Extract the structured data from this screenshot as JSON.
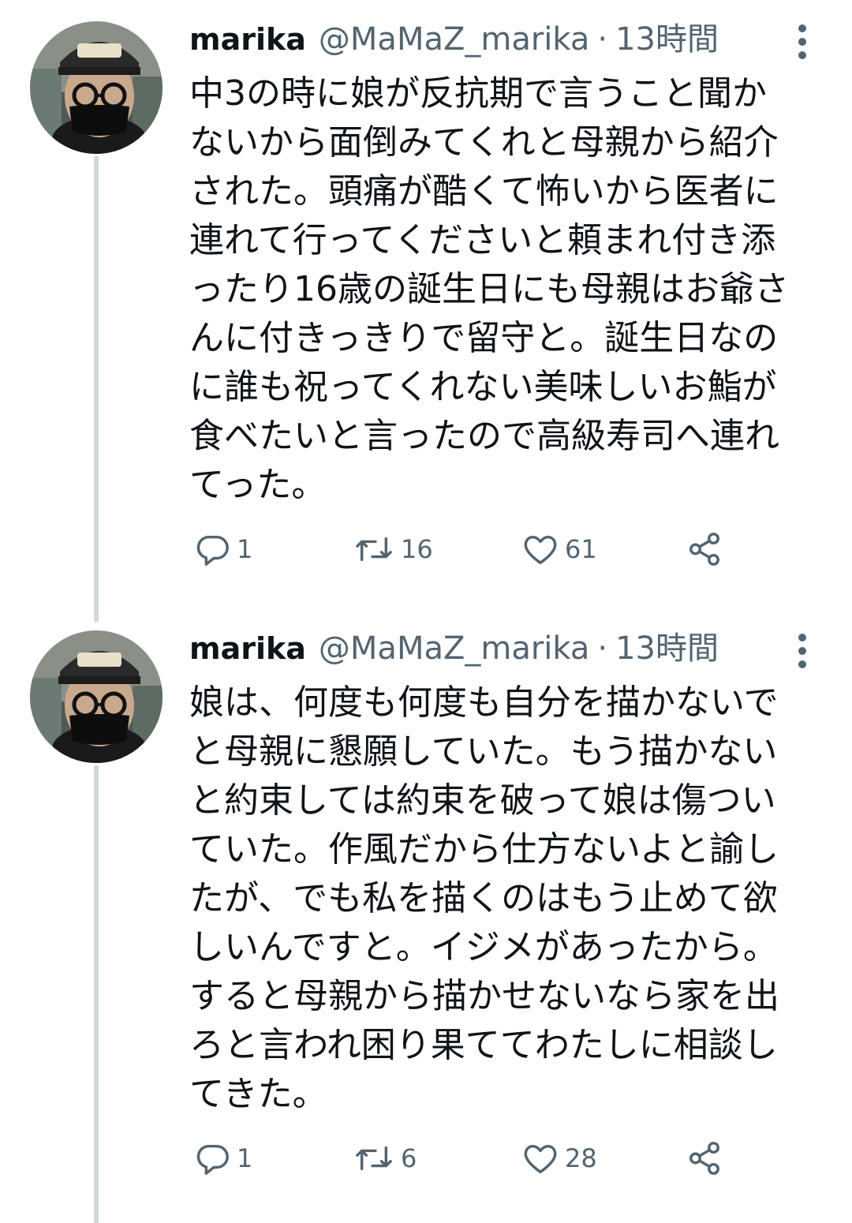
{
  "tweets": [
    {
      "author_name": "marika",
      "author_handle": "@MaMaZ_marika",
      "separator": "·",
      "time": "13時間",
      "lines": [
        "中3の時に娘が反抗期で言うこと聞か",
        "ないから面倒みてくれと母親から紹介",
        "された。頭痛が酷くて怖いから医者に",
        "連れて行ってくださいと頼まれ付き添",
        "ったり16歳の誕生日にも母親はお爺さ",
        "んに付きっきりで留守と。誕生日なの",
        "に誰も祝ってくれない美味しいお鮨が",
        "食べたいと言ったので高級寿司へ連れ",
        "てった。"
      ],
      "reply_count": "1",
      "retweet_count": "16",
      "like_count": "61"
    },
    {
      "author_name": "marika",
      "author_handle": "@MaMaZ_marika",
      "separator": "·",
      "time": "13時間",
      "lines": [
        "娘は、何度も何度も自分を描かないで",
        "と母親に懇願していた。もう描かない",
        "と約束しては約束を破って娘は傷つい",
        "ていた。作風だから仕方ないよと諭し",
        "たが、でも私を描くのはもう止めて欲",
        "しいんですと。イジメがあったから。",
        "すると母親から描かせないなら家を出",
        "ろと言われ困り果ててわたしに相談し",
        "てきた。"
      ],
      "reply_count": "1",
      "retweet_count": "6",
      "like_count": "28"
    }
  ],
  "icons": {
    "avatar": "user-avatar",
    "more": "more-vertical-icon",
    "reply": "reply-icon",
    "retweet": "retweet-icon",
    "like": "heart-icon",
    "share": "share-icon"
  },
  "colors": {
    "text": "#0f1419",
    "secondary": "#536471",
    "thread_line": "#cfd9de"
  }
}
